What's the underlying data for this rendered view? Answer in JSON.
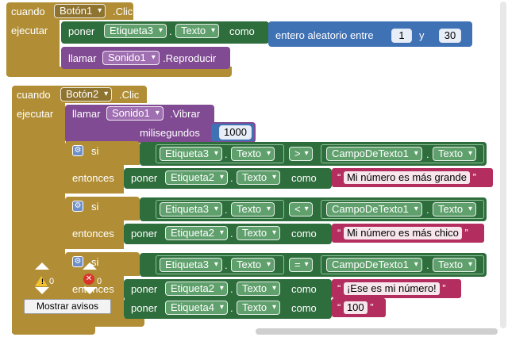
{
  "block1": {
    "when": "cuando",
    "component": "Botón1",
    "event": ".Clic",
    "do": "ejecutar",
    "set": "poner",
    "target": "Etiqueta3",
    "dot": ".",
    "property": "Texto",
    "to": "como",
    "random_label": "entero aleatorio entre",
    "random_from": "1",
    "random_and": "y",
    "random_to": "30",
    "call": "llamar",
    "call_component": "Sonido1",
    "call_method": ".Reproducir"
  },
  "block2": {
    "when": "cuando",
    "component": "Botón2",
    "event": ".Clic",
    "do": "ejecutar",
    "call": "llamar",
    "call_component": "Sonido1",
    "call_method": ".Vibrar",
    "ms_label": "milisegundos",
    "ms_value": "1000",
    "if_label": "si",
    "then_label": "entonces",
    "set": "poner",
    "dot": ".",
    "to": "como",
    "conditions": [
      {
        "left_component": "Etiqueta3",
        "left_property": "Texto",
        "operator": ">",
        "right_component": "CampoDeTexto1",
        "right_property": "Texto",
        "actions": [
          {
            "target": "Etiqueta2",
            "property": "Texto",
            "value": "Mi número es más grande"
          }
        ]
      },
      {
        "left_component": "Etiqueta3",
        "left_property": "Texto",
        "operator": "<",
        "right_component": "CampoDeTexto1",
        "right_property": "Texto",
        "actions": [
          {
            "target": "Etiqueta2",
            "property": "Texto",
            "value": "Mi número es más chico"
          }
        ]
      },
      {
        "left_component": "Etiqueta3",
        "left_property": "Texto",
        "operator": "=",
        "right_component": "CampoDeTexto1",
        "right_property": "Texto",
        "actions": [
          {
            "target": "Etiqueta2",
            "property": "Texto",
            "value": "¡Ese es mi número!"
          },
          {
            "target": "Etiqueta4",
            "property": "Texto",
            "value": "100"
          }
        ]
      }
    ]
  },
  "warnings": {
    "warning_count": "0",
    "error_count": "0",
    "toggle_label": "Mostrar avisos"
  },
  "colors": {
    "event": "#b18e35",
    "setter": "#2e6d3c",
    "call": "#804b93",
    "math": "#3f71b5",
    "text": "#b32d5e"
  }
}
